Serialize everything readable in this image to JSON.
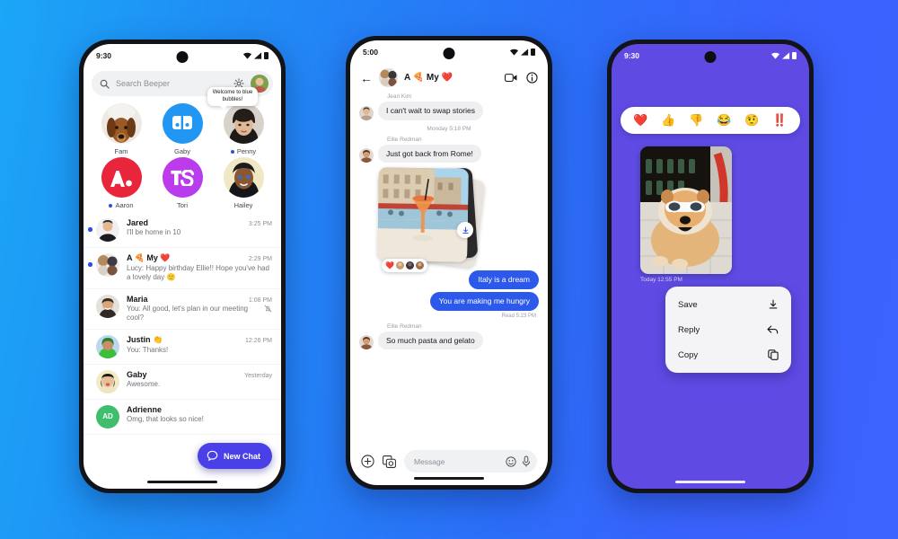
{
  "background": {
    "from": "#1BA6F7",
    "to": "#3D63FF"
  },
  "phone1": {
    "status": {
      "time": "9:30"
    },
    "search": {
      "placeholder": "Search Beeper"
    },
    "pinned": [
      {
        "name": "Fam",
        "unread": false
      },
      {
        "name": "Gaby",
        "unread": false
      },
      {
        "name": "Penny",
        "unread": true,
        "tooltip": "Welcome to blue bubbles!"
      },
      {
        "name": "Aaron",
        "unread": true
      },
      {
        "name": "Tori",
        "unread": false
      },
      {
        "name": "Hailey",
        "unread": false
      }
    ],
    "chats": [
      {
        "name": "Jared",
        "preview": "I'll be home in 10",
        "time": "3:25 PM",
        "unread": true,
        "muted": false
      },
      {
        "name": "A 🍕 My ❤️",
        "preview": "Lucy: Happy birthday Ellie!! Hope you've had a lovely day  🙂",
        "time": "2:29 PM",
        "unread": true,
        "muted": false
      },
      {
        "name": "Maria",
        "preview": "You: All good, let's plan in our meeting cool?",
        "time": "1:08 PM",
        "unread": false,
        "muted": true
      },
      {
        "name": "Justin 👏",
        "preview": "You: Thanks!",
        "time": "12:26 PM",
        "unread": false,
        "muted": false
      },
      {
        "name": "Gaby",
        "preview": "Awesome.",
        "time": "Yesterday",
        "unread": false,
        "muted": false
      },
      {
        "name": "Adrienne",
        "preview": "Omg, that looks so nice!",
        "time": "",
        "unread": false,
        "muted": false,
        "initials": "AD"
      }
    ],
    "fab": {
      "label": "New Chat",
      "icon": "chat-bubble-icon",
      "color": "#4A40E8"
    }
  },
  "phone2": {
    "status": {
      "time": "5:00"
    },
    "header": {
      "title": "A 🍕 My ❤️",
      "back": "back-arrow-icon",
      "video": "video-call-icon",
      "info": "info-icon"
    },
    "messages": [
      {
        "type": "incoming",
        "sender": "Jean Kim",
        "text": "I can't wait to swap stories"
      },
      {
        "type": "daystamp",
        "text": "Monday 5:18 PM"
      },
      {
        "type": "incoming",
        "sender": "Ellie Redman",
        "text": "Just got back from Rome!"
      },
      {
        "type": "photos",
        "reaction": "❤️"
      },
      {
        "type": "outgoing",
        "text": "Italy is a dream"
      },
      {
        "type": "outgoing",
        "text": "You are making me hungry",
        "receipt": "Read  5:23 PM"
      },
      {
        "type": "incoming",
        "sender": "Ellie Redman",
        "text": "So much pasta and gelato"
      }
    ],
    "input": {
      "placeholder": "Message",
      "plus": "plus-icon",
      "gallery": "gallery-camera-icon",
      "emoji": "emoji-icon",
      "mic": "microphone-icon"
    },
    "bubble_color": "#2D59EA"
  },
  "phone3": {
    "status": {
      "time": "9:30"
    },
    "background": "#5F4BE4",
    "reactions": [
      "❤️",
      "👍",
      "👎",
      "😂",
      "🤨",
      "‼️"
    ],
    "photo_timestamp": "Today  12:55 PM",
    "menu": [
      {
        "label": "Save",
        "icon": "download-icon"
      },
      {
        "label": "Reply",
        "icon": "reply-arrow-icon"
      },
      {
        "label": "Copy",
        "icon": "copy-icon"
      }
    ]
  }
}
